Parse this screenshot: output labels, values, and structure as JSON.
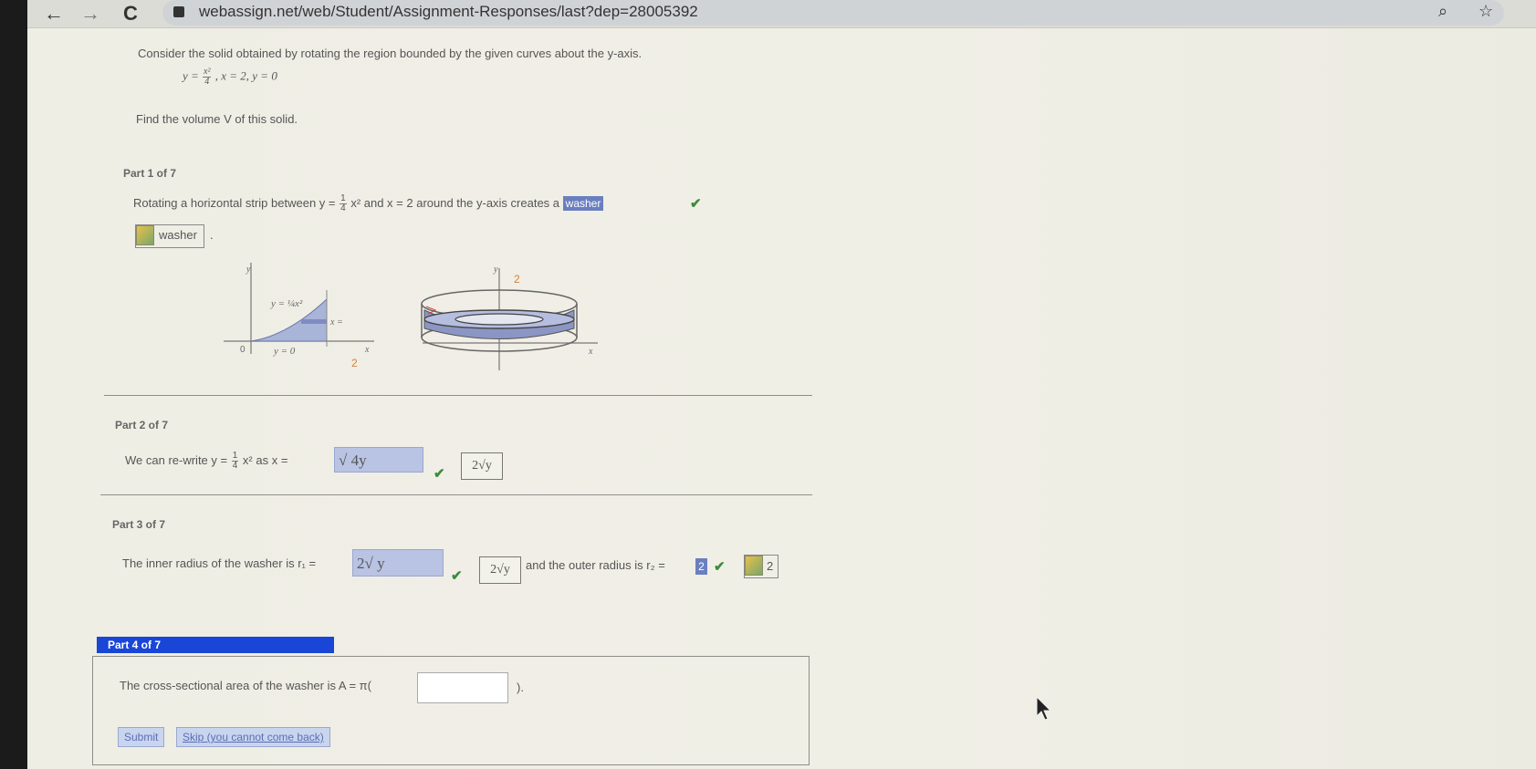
{
  "browser": {
    "back_glyph": "←",
    "forward_glyph": "→",
    "reload_glyph": "C",
    "url": "webassign.net/web/Student/Assignment-Responses/last?dep=28005392",
    "zoom_glyph": "⌕",
    "star_glyph": "☆"
  },
  "problem": {
    "intro": "Consider the solid obtained by rotating the region bounded by the given curves about the y-axis.",
    "eq_y": "y =",
    "eq_num": "x²",
    "eq_den": "4",
    "eq_rest": ",  x = 2,  y = 0",
    "find": "Find the volume V of this solid."
  },
  "part1": {
    "label": "Part 1 of 7",
    "text_a": "Rotating a horizontal strip between  y =",
    "frac_num": "1",
    "frac_den": "4",
    "text_b": "x²  and x = 2 around the y-axis creates a",
    "answer": "washer",
    "key_answer": "washer",
    "period": ".",
    "graph_left": {
      "y_axis": "y",
      "curve_label": "y = ¼x²",
      "x_eq": "x =",
      "y0": "y = 0",
      "origin": "0",
      "x_axis": "x",
      "two": "2"
    },
    "graph_right": {
      "y_axis": "y",
      "two": "2",
      "x_axis": "x"
    }
  },
  "part2": {
    "label": "Part 2 of 7",
    "text_a": "We can re-write  y =",
    "frac_num": "1",
    "frac_den": "4",
    "text_b": "x²  as  x =",
    "answer": "√ 4y",
    "key_answer": "2√y"
  },
  "part3": {
    "label": "Part 3 of 7",
    "text_a": "The inner radius of the washer is r₁ =",
    "answer_inner": "2√ y",
    "key_inner": "2√y",
    "text_b": "and the outer radius is r₂ =",
    "answer_outer": "2",
    "key_outer": "2"
  },
  "part4": {
    "label": "Part 4 of 7",
    "text_a": "The cross-sectional area of the washer is A = π(",
    "text_b": ").",
    "input_value": "",
    "submit": "Submit",
    "skip": "Skip (you cannot come back)"
  },
  "colors": {
    "part_header": "#1946d6",
    "answer_highlight": "#b9c3e3",
    "check_green": "#3d8b3d"
  },
  "icons": [
    "back-arrow-icon",
    "forward-arrow-icon",
    "reload-icon",
    "lock-icon",
    "zoom-icon",
    "star-icon",
    "check-icon",
    "key-icon",
    "mouse-cursor-icon"
  ]
}
